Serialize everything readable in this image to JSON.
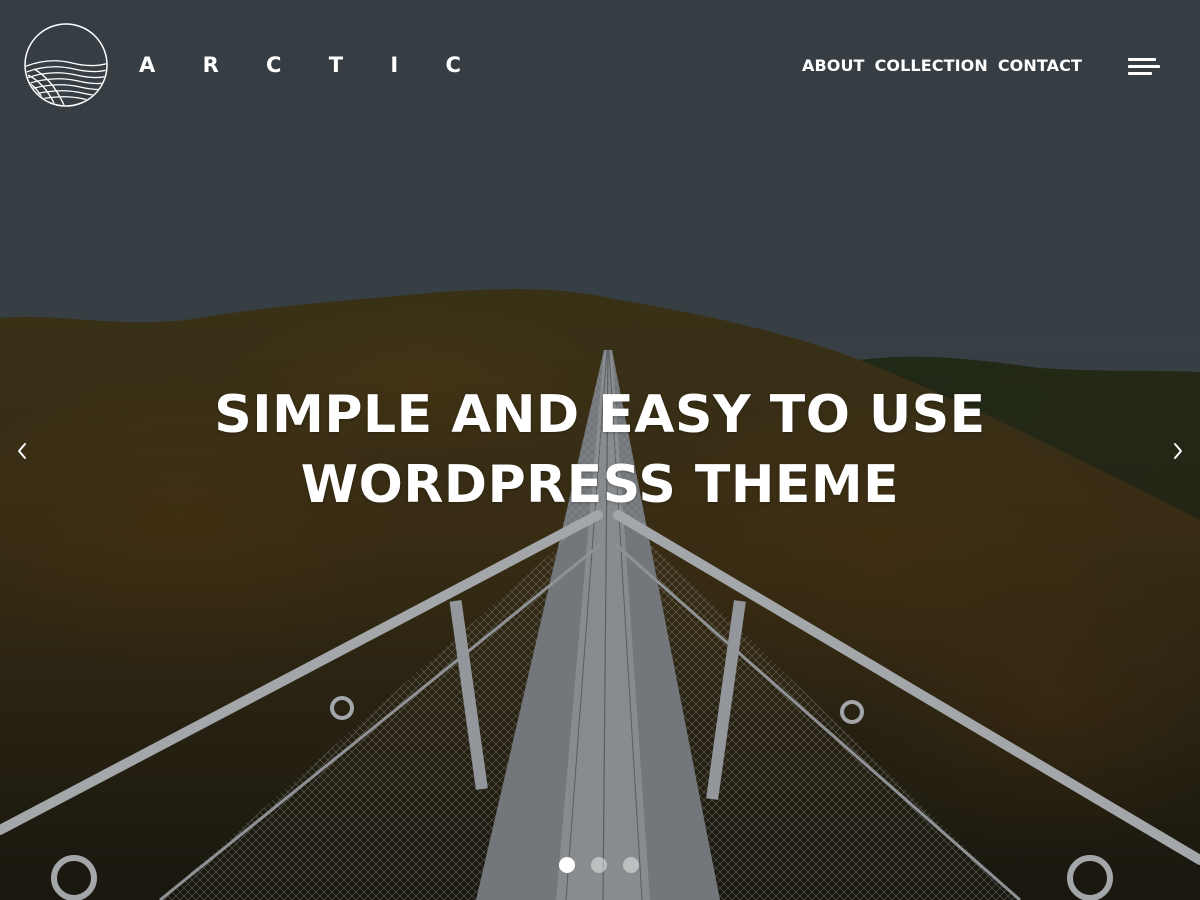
{
  "brand": {
    "name": "A R C T I C",
    "logo_icon": "waves-circle-icon"
  },
  "nav": {
    "items": [
      {
        "label": "ABOUT"
      },
      {
        "label": "COLLECTION"
      },
      {
        "label": "CONTACT"
      }
    ],
    "menu_icon": "hamburger-menu-icon"
  },
  "hero": {
    "title_line1": "SIMPLE AND EASY TO USE",
    "title_line2": "WORDPRESS THEME",
    "image_subject": "suspension-bridge-over-forested-hills"
  },
  "slider": {
    "prev_icon": "chevron-left-icon",
    "next_icon": "chevron-right-icon",
    "slide_count": 3,
    "active_index": 0
  },
  "colors": {
    "text": "#ffffff",
    "sky": "#4a545c",
    "forest": "#5a4a22"
  }
}
